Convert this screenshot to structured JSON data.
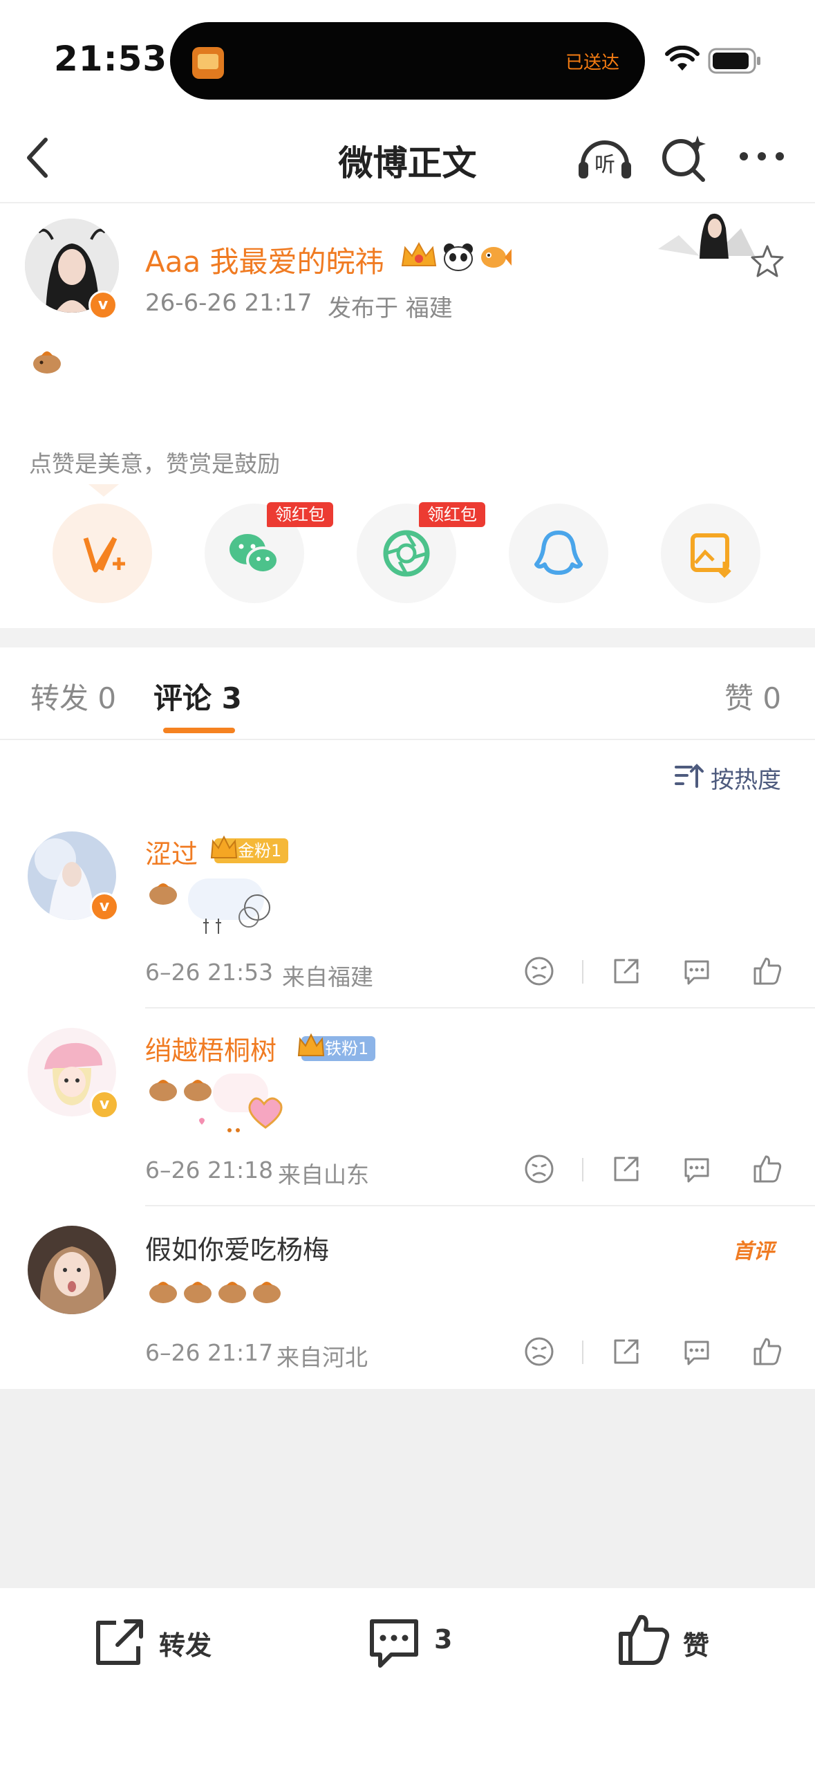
{
  "status_bar": {
    "time": "21:53",
    "island_text": "已送达"
  },
  "nav": {
    "title": "微博正文",
    "icons": [
      "back-icon",
      "listen-icon",
      "search-icon",
      "more-icon"
    ]
  },
  "post": {
    "author": "Aaa 我最爱的皖祎",
    "time": "26-6-26 21:17",
    "location": "发布于 福建",
    "reward_prompt": "点赞是美意，赞赏是鼓励",
    "share_buttons": [
      {
        "icon": "weibo-vplus-icon",
        "badge": ""
      },
      {
        "icon": "wechat-icon",
        "badge": "领红包"
      },
      {
        "icon": "moments-icon",
        "badge": "领红包"
      },
      {
        "icon": "qq-icon",
        "badge": ""
      },
      {
        "icon": "save-image-icon",
        "badge": ""
      }
    ]
  },
  "tabs": {
    "repost": "转发 0",
    "comments": "评论 3",
    "likes": "赞 0"
  },
  "sort": {
    "label": "按热度"
  },
  "comments": [
    {
      "name": "涩过",
      "badge": "金粉1",
      "time": "6–26 21:53",
      "location": "来自福建"
    },
    {
      "name": "绡越梧桐树",
      "badge": "铁粉1",
      "time": "6–26 21:18",
      "location": "来自山东"
    },
    {
      "name": "假如你爱吃杨梅",
      "badge": "首评",
      "time": "6–26 21:17",
      "location": "来自河北"
    }
  ],
  "bottom_bar": {
    "repost": "转发",
    "comment_count": "3",
    "like": "赞"
  },
  "colors": {
    "accent": "#f58220",
    "name": "#f07b22",
    "hongbao": "#ec3b32",
    "wechat": "#4cc28b",
    "qq": "#4aa5ea"
  }
}
